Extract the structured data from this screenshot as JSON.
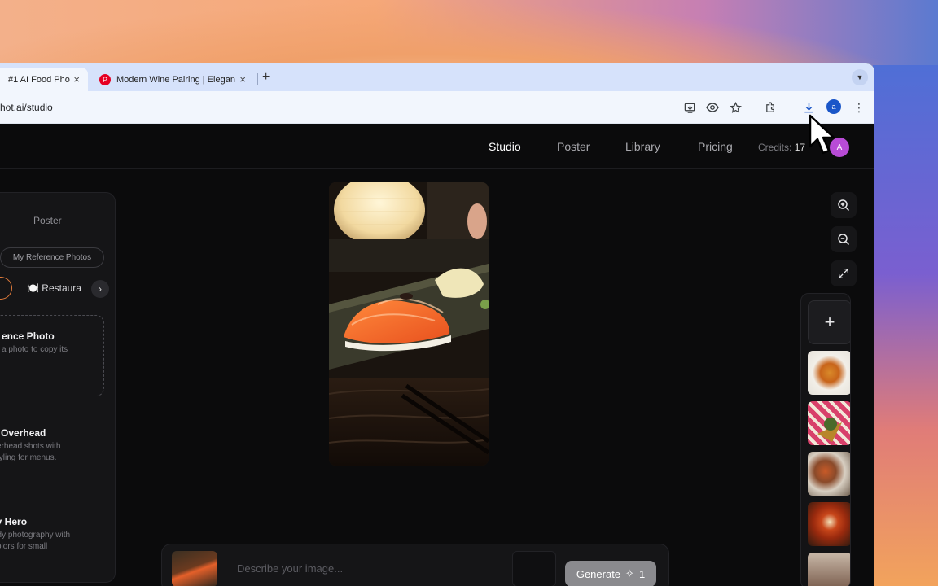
{
  "browser": {
    "tabs": [
      {
        "title": "#1 AI Food Pho",
        "active": true
      },
      {
        "title": "Modern Wine Pairing | Elegan",
        "active": false
      }
    ],
    "new_tab_label": "+",
    "tab_close": "×",
    "url": "hot.ai/studio",
    "profile_initial": "a",
    "icons": [
      "install-icon",
      "eye-icon",
      "star-icon",
      "extensions-icon",
      "download-icon",
      "more-icon"
    ]
  },
  "nav": {
    "items": [
      "Studio",
      "Poster",
      "Library",
      "Pricing"
    ],
    "active": "Studio",
    "credits_label": "Credits:",
    "credits_value": "17",
    "avatar_initial": "A"
  },
  "left_panel": {
    "tab_poster": "Poster",
    "reference_pill": "My Reference Photos",
    "chip_restaurant": "🍽️ Restaura",
    "reference_card": {
      "title": "ence Photo",
      "desc": "a photo to copy its"
    },
    "styles": [
      {
        "title": "e Overhead",
        "desc_lines": [
          "verhead shots with",
          "styling for menus."
        ]
      },
      {
        "title": "ry Hero",
        "desc_lines": [
          "ady photography with",
          "colors for small",
          "."
        ]
      }
    ]
  },
  "canvas": {
    "image_icon": "sushi-photo"
  },
  "prompt": {
    "placeholder": "Describe your image...",
    "generate_label": "Generate",
    "generate_cost": "1"
  },
  "colors": {
    "accent_orange": "#e07a3a",
    "avatar_purple": "#b84bd6",
    "profile_blue": "#1a56c8"
  }
}
